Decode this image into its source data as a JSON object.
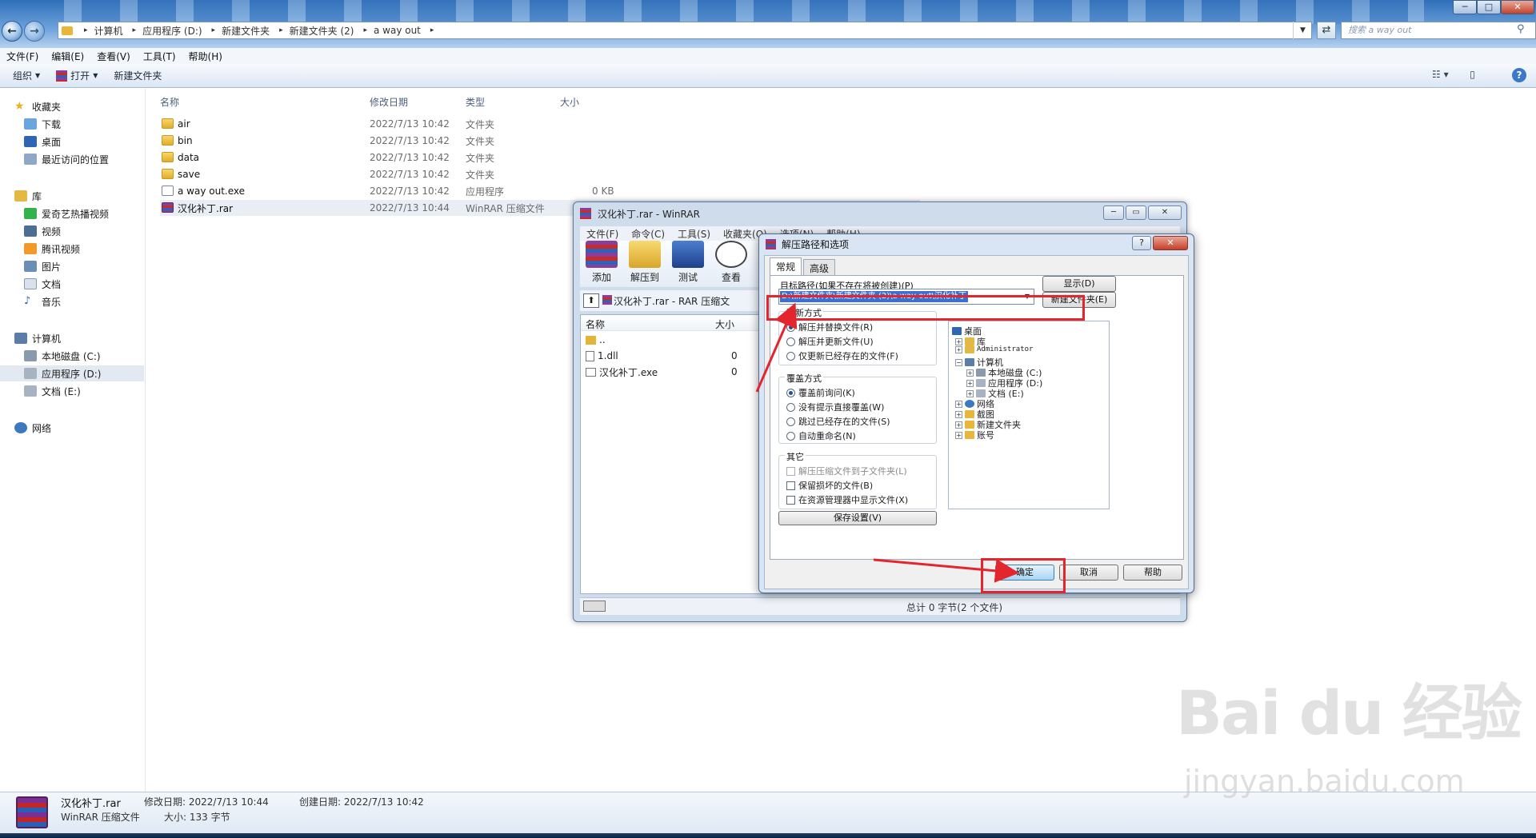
{
  "explorer": {
    "breadcrumb": [
      "计算机",
      "应用程序 (D:)",
      "新建文件夹",
      "新建文件夹 (2)",
      "a way out"
    ],
    "search_placeholder": "搜索 a way out",
    "menu": [
      "文件(F)",
      "编辑(E)",
      "查看(V)",
      "工具(T)",
      "帮助(H)"
    ],
    "toolbar": {
      "organize": "组织",
      "open": "打开",
      "new_folder": "新建文件夹"
    },
    "nav": {
      "favorites": "收藏夹",
      "downloads": "下载",
      "desktop": "桌面",
      "recent": "最近访问的位置",
      "libraries": "库",
      "iqiyi": "爱奇艺热播视频",
      "videos": "视频",
      "tencent": "腾讯视频",
      "pictures": "图片",
      "documents": "文档",
      "music": "音乐",
      "computer": "计算机",
      "drive_c": "本地磁盘 (C:)",
      "drive_d": "应用程序 (D:)",
      "drive_e": "文档 (E:)",
      "network": "网络"
    },
    "columns": {
      "name": "名称",
      "modified": "修改日期",
      "type": "类型",
      "size": "大小"
    },
    "files": [
      {
        "name": "air",
        "date": "2022/7/13 10:42",
        "type": "文件夹",
        "size": ""
      },
      {
        "name": "bin",
        "date": "2022/7/13 10:42",
        "type": "文件夹",
        "size": ""
      },
      {
        "name": "data",
        "date": "2022/7/13 10:42",
        "type": "文件夹",
        "size": ""
      },
      {
        "name": "save",
        "date": "2022/7/13 10:42",
        "type": "文件夹",
        "size": ""
      },
      {
        "name": "a way out.exe",
        "date": "2022/7/13 10:42",
        "type": "应用程序",
        "size": "0 KB"
      },
      {
        "name": "汉化补丁.rar",
        "date": "2022/7/13 10:44",
        "type": "WinRAR 压缩文件",
        "size": ""
      }
    ],
    "details": {
      "name": "汉化补丁.rar",
      "type": "WinRAR 压缩文件",
      "modified": "修改日期: 2022/7/13 10:44",
      "size": "大小: 133 字节",
      "created": "创建日期: 2022/7/13 10:42"
    }
  },
  "winrar": {
    "title": "汉化补丁.rar - WinRAR",
    "menu": [
      "文件(F)",
      "命令(C)",
      "工具(S)",
      "收藏夹(O)",
      "选项(N)",
      "帮助(H)"
    ],
    "tools": [
      "添加",
      "解压到",
      "测试",
      "查看"
    ],
    "path": "汉化补丁.rar - RAR 压缩文",
    "columns": {
      "name": "名称",
      "size": "大小"
    },
    "files": [
      {
        "name": "..",
        "size": ""
      },
      {
        "name": "1.dll",
        "size": "0"
      },
      {
        "name": "汉化补丁.exe",
        "size": "0"
      }
    ],
    "status": "总计 0 字节(2 个文件)"
  },
  "dialog": {
    "title": "解压路径和选项",
    "tabs": [
      "常规",
      "高级"
    ],
    "dest_label": "目标路径(如果不存在将被创建)(P)",
    "dest_value": "D:\\新建文件夹\\新建文件夹 (2)\\a way out\\汉化补丁",
    "show_btn": "显示(D)",
    "newfolder_btn": "新建文件夹(E)",
    "update_group": "更新方式",
    "update_opts": [
      "解压并替换文件(R)",
      "解压并更新文件(U)",
      "仅更新已经存在的文件(F)"
    ],
    "overwrite_group": "覆盖方式",
    "overwrite_opts": [
      "覆盖前询问(K)",
      "没有提示直接覆盖(W)",
      "跳过已经存在的文件(S)",
      "自动重命名(N)"
    ],
    "misc_group": "其它",
    "misc_opts": [
      "解压压缩文件到子文件夹(L)",
      "保留损坏的文件(B)",
      "在资源管理器中显示文件(X)"
    ],
    "save_btn": "保存设置(V)",
    "tree": [
      "桌面",
      "库",
      "Administrator",
      "计算机",
      "本地磁盘 (C:)",
      "应用程序 (D:)",
      "文档 (E:)",
      "网络",
      "截图",
      "新建文件夹",
      "账号"
    ],
    "ok": "确定",
    "cancel": "取消",
    "help": "帮助"
  },
  "watermark": {
    "brand": "Bai  du 经验",
    "url": "jingyan.baidu.com"
  }
}
